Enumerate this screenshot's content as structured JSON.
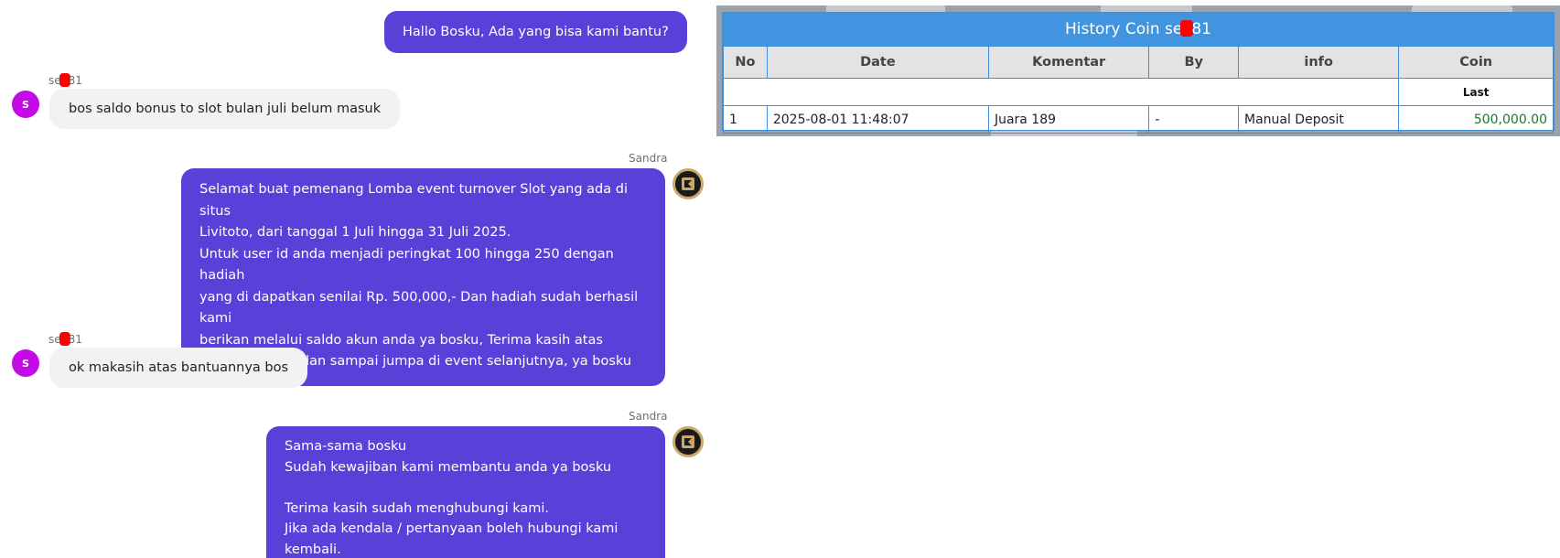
{
  "chat": {
    "messages": [
      {
        "role": "agent",
        "sender": "",
        "text": "Hallo Bosku, Ada yang bisa kami bantu?"
      },
      {
        "role": "user",
        "sender_prefix": "se",
        "sender_suffix": "81",
        "avatar_letter": "S",
        "text": "bos saldo bonus to slot bulan juli belum masuk"
      },
      {
        "role": "agent",
        "sender": "Sandra",
        "text": "Selamat buat pemenang Lomba event turnover Slot yang ada di situs\nLivitoto, dari tanggal 1 Juli hingga 31 Juli 2025.\nUntuk user id anda menjadi peringkat 100 hingga 250 dengan hadiah\nyang di dapatkan senilai Rp. 500,000,- Dan hadiah sudah berhasil kami\nberikan melalui saldo akun anda ya bosku, Terima kasih atas\npartisipasinya, dan sampai jumpa di event selanjutnya, ya bosku"
      },
      {
        "role": "user",
        "sender_prefix": "se",
        "sender_suffix": "81",
        "avatar_letter": "S",
        "text": "ok makasih atas bantuannya bos"
      },
      {
        "role": "agent",
        "sender": "Sandra",
        "text": "Sama-sama bosku\nSudah kewajiban kami membantu anda ya bosku\n\nTerima kasih sudah menghubungi kami.\nJika ada kendala / pertanyaan boleh hubungi kami kembali."
      }
    ]
  },
  "history": {
    "title_prefix": "History Coin se",
    "title_suffix": "81",
    "columns": [
      "No",
      "Date",
      "Komentar",
      "By",
      "info",
      "Coin"
    ],
    "sub_header": "Last",
    "rows": [
      {
        "no": "1",
        "date": "2025-08-01 11:48:07",
        "komentar": "Juara 189",
        "by": "-",
        "info": "Manual Deposit",
        "coin": "500,000.00"
      }
    ]
  },
  "colors": {
    "agent_bubble": "#5a40d8",
    "user_bubble": "#f2f2f3",
    "user_avatar": "#c40be6",
    "table_header": "#4195e0",
    "coin_value": "#157a2c",
    "redaction": "#ff0000"
  },
  "icons": {
    "user_avatar": "letter-avatar",
    "agent_avatar": "brand-logo-icon"
  }
}
